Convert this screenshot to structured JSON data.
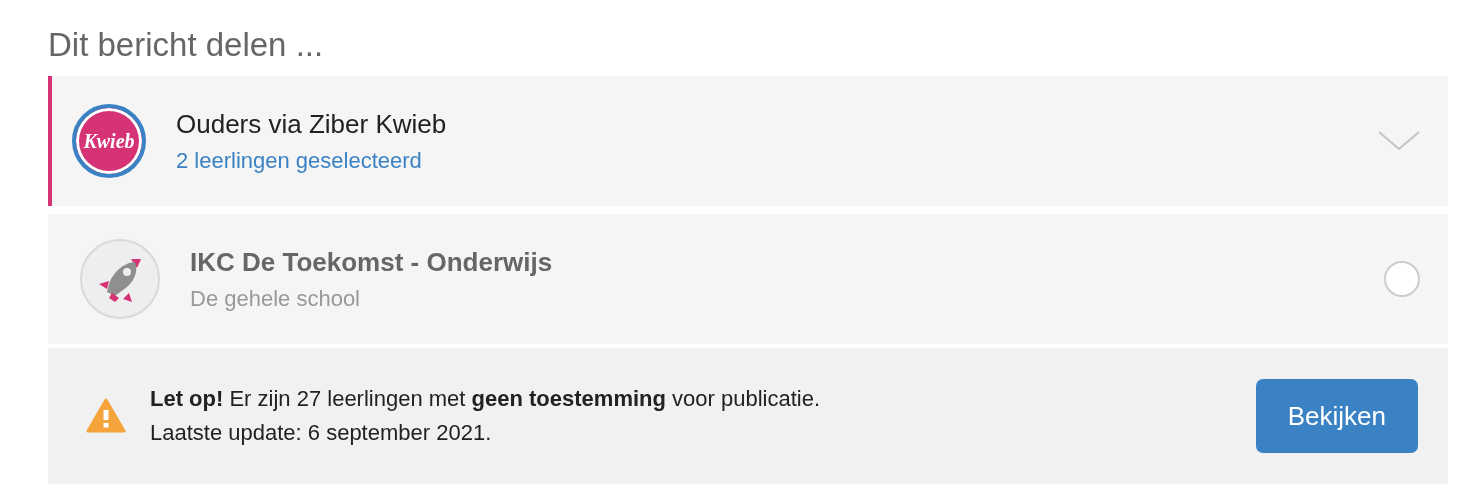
{
  "heading": "Dit bericht delen ...",
  "options": [
    {
      "kind": "dropdown",
      "selected": true,
      "logo_text": "Kwieb",
      "title": "Ouders via Ziber Kwieb",
      "subtitle": "2 leerlingen geselecteerd"
    },
    {
      "kind": "radio",
      "selected": false,
      "title": "IKC De Toekomst - Onderwijs",
      "subtitle": "De gehele school"
    }
  ],
  "notice": {
    "lines": [
      "**Let op!** Er zijn 27 leerlingen met **geen toestemming** voor publicatie.",
      "Laatste update: 6 september 2021."
    ],
    "button": "Bekijken"
  }
}
